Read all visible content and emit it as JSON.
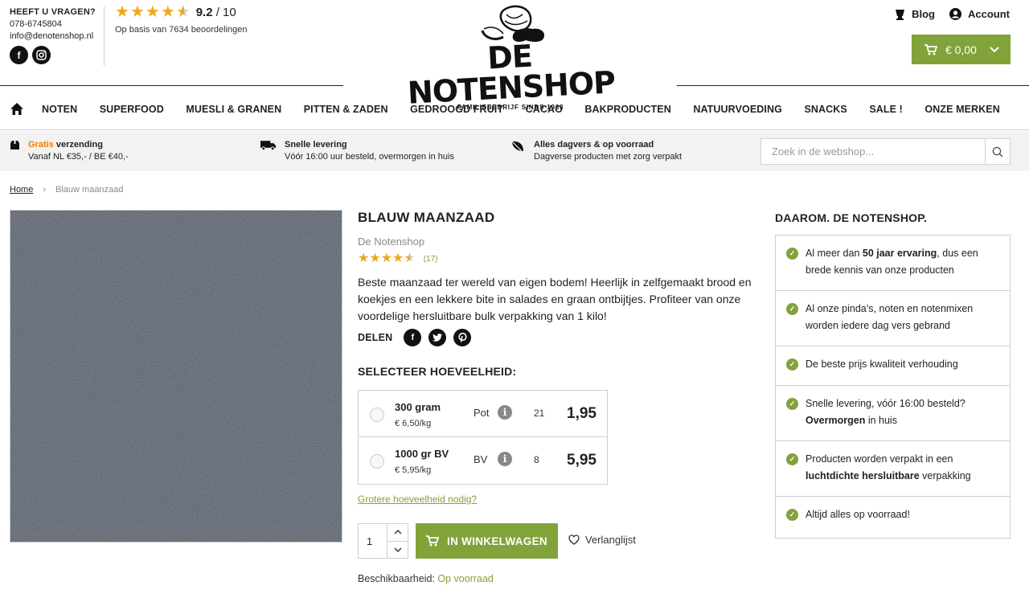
{
  "header": {
    "question": "HEEFT U VRAGEN?",
    "phone": "078-6745804",
    "email": "info@denotenshop.nl",
    "rating_score": "9.2",
    "rating_scale": " / 10",
    "rating_value": 4.5,
    "rating_sub": "Op basis van 7634 beoordelingen",
    "brand": "DE NOTENSHOP",
    "tagline": "FAMILIEBEDRIJF SINDS 1963",
    "blog": "Blog",
    "account": "Account",
    "cart_amount": "€ 0,00"
  },
  "nav": [
    "NOTEN",
    "SUPERFOOD",
    "MUESLI & GRANEN",
    "PITTEN & ZADEN",
    "GEDROOGD FRUIT",
    "CACAO",
    "BAKPRODUCTEN",
    "NATUURVOEDING",
    "SNACKS",
    "SALE !",
    "ONZE MERKEN"
  ],
  "usp": {
    "shipping_highlight": "Gratis",
    "shipping_title": " verzending",
    "shipping_sub": "Vanaf NL €35,- / BE €40,-",
    "delivery_title": "Snelle levering",
    "delivery_sub": "Vóór 16:00 uur besteld, overmorgen in huis",
    "fresh_title": "Alles dagvers & op voorraad",
    "fresh_sub": "Dagverse producten met zorg verpakt",
    "search_placeholder": "Zoek in de webshop..."
  },
  "breadcrumb": {
    "home": "Home",
    "current": "Blauw maanzaad"
  },
  "product": {
    "title": "BLAUW MAANZAAD",
    "brand": "De Notenshop",
    "rating_value": 4.5,
    "review_count": "(17)",
    "description": "Beste maanzaad ter wereld van eigen bodem! Heerlijk in zelfgemaakt brood en koekjes en een lekkere bite in salades en graan ontbijtjes. Profiteer van onze voordelige hersluitbare bulk verpakking van 1 kilo!",
    "share_label": "DELEN",
    "select_heading": "SELECTEER HOEVEELHEID:",
    "options": [
      {
        "name": "300 gram",
        "per_kg": "€ 6,50/kg",
        "type": "Pot",
        "stock": "21",
        "price": "1,95"
      },
      {
        "name": "1000 gr BV",
        "per_kg": "€ 5,95/kg",
        "type": "BV",
        "stock": "8",
        "price": "5,95"
      }
    ],
    "bigger_link": "Grotere hoeveelheid nodig?",
    "quantity": "1",
    "add_to_cart": "IN WINKELWAGEN",
    "wishlist": "Verlanglijst",
    "availability_label": "Beschikbaarheid: ",
    "availability_value": "Op voorraad"
  },
  "why": {
    "title": "DAAROM. DE NOTENSHOP.",
    "items": [
      {
        "a": "Al meer dan ",
        "b": "50 jaar ervaring",
        "c": ", dus een brede kennis van onze producten"
      },
      {
        "a": "Al onze pinda’s, noten en notenmixen worden iedere dag vers gebrand",
        "b": "",
        "c": ""
      },
      {
        "a": "De beste prijs kwaliteit verhouding",
        "b": "",
        "c": ""
      },
      {
        "a": "Snelle levering, vóór 16:00 besteld? ",
        "b": "Overmorgen",
        "c": " in huis"
      },
      {
        "a": "Producten worden verpakt in een ",
        "b": "luchtdichte hersluitbare",
        "c": " verpakking"
      },
      {
        "a": "Altijd alles op voorraad!",
        "b": "",
        "c": ""
      }
    ]
  },
  "colors": {
    "accent": "#82a23a",
    "orange": "#f07d00",
    "star": "#f0a81a"
  }
}
